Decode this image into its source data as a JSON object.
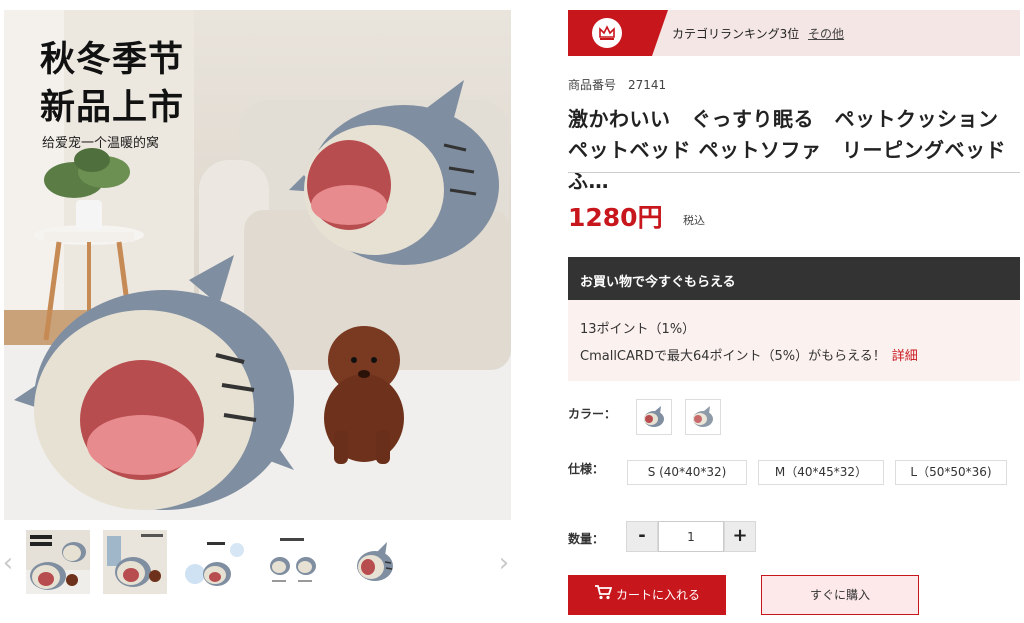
{
  "promo": {
    "line1": "秋冬季节",
    "line2": "新品上市",
    "subtitle": "给爱宠一个温暖的窝"
  },
  "gallery": {
    "prev_icon": "‹",
    "next_icon": "›",
    "thumbnail_count": 5
  },
  "ranking": {
    "icon": "crown-icon",
    "text": "カテゴリランキング3位",
    "link": "その他"
  },
  "product": {
    "sku_label": "商品番号",
    "sku_value": "27141",
    "title": "激かわいい　ぐっすり眠る　ペットクッション　ペットベッド ペットソファ　リーピングベッド　ふ…",
    "price": "1280円",
    "tax": "税込"
  },
  "points": {
    "header": "お買い物で今すぐもらえる",
    "line1": "13ポイント（1%）",
    "line2": "CmallCARDで最大64ポイント（5%）がもらえる！",
    "detail_link": "詳細"
  },
  "options": {
    "color_label": "カラー：",
    "size_label": "仕様：",
    "sizes": [
      "S (40*40*32)",
      "M（40*45*32）",
      "L（50*50*36)"
    ],
    "quantity_label": "数量：",
    "minus": "-",
    "plus": "+",
    "quantity": "1"
  },
  "actions": {
    "cart": "カートに入れる",
    "buy": "すぐに購入"
  },
  "colors": {
    "brand_red": "#c8161d",
    "rank_bg": "#f3e6e4",
    "points_bg": "#fbf1ef",
    "shark_gray": "#7f8ea0",
    "cushion_pink": "#e78b8e"
  }
}
